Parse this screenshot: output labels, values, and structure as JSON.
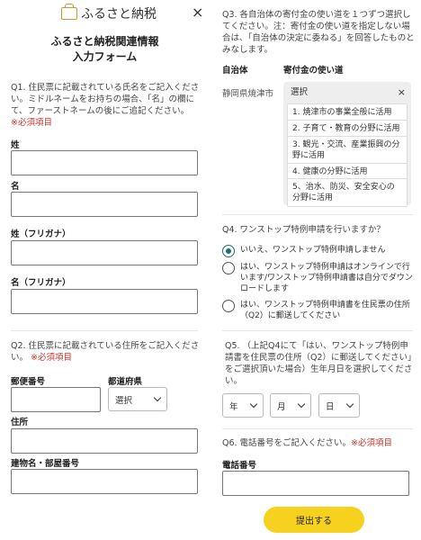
{
  "header": {
    "logo_text": "ふるさと納税",
    "close_icon": "×",
    "title_line1": "ふるさと納税関連情報",
    "title_line2": "入力フォーム"
  },
  "q1": {
    "text": "Q1. 住民票に記載されている氏名をご記入ください。ミドルネームをお持ちの場合、「名」の欄にて、ファーストネームの後にご追記ください。",
    "required": "※必須項目",
    "labels": [
      "姓",
      "名",
      "姓（フリガナ）",
      "名（フリガナ）"
    ]
  },
  "q2": {
    "text": "Q2. 住民票に記載されている住所をご記入ください。",
    "required": "※必須項目",
    "postal_label": "郵便番号",
    "pref_label": "都道府県",
    "pref_select": "選択",
    "address_label": "住所",
    "building_label": "建物名・部屋番号"
  },
  "q3": {
    "text": "Q3. 各自治体の寄付金の使い道を１つずつ選択してください。注：寄付金の使い道を指定しない場合は、「自治体の決定に委ねる」を回答したものとみなします。",
    "col_municipality": "自治体",
    "col_usage": "寄付金の使い道",
    "municipality": "静岡県焼津市",
    "select_header": "選択",
    "close_icon": "×",
    "options": [
      "1. 焼津市の事業全般に活用",
      "2. 子育て・教育の分野に活用",
      "3. 観光・交流、産業振興の分野に活用",
      "4. 健康の分野に活用",
      "5、治水、防災、安全安心の分野に活用"
    ]
  },
  "q4": {
    "text": "Q4. ワンストップ特例申請を行いますか？",
    "options": [
      "いいえ、ワンストップ特例申請しません",
      "はい、ワンストップ特例申請はオンラインで行います/ワンストップ特例申請書は自分でダウンロードします",
      "はい、ワンストップ特例申請書を住民票の住所（Q2）に郵送してください"
    ],
    "selected_index": 0
  },
  "q5": {
    "text": "Q5. （上記Q4にて「はい、ワンストップ特例申請書を住民票の住所（Q2）に郵送してください」をご選択頂いた場合）生年月日を選択してください。",
    "year": "年",
    "month": "月",
    "day": "日"
  },
  "q6": {
    "text": "Q6. 電話番号をご記入ください。",
    "required": "※必須項目",
    "phone_label": "電話番号"
  },
  "submit_label": "提出する",
  "colors": {
    "required": "#d0342c",
    "submit_bg": "#f6d21e",
    "radio_selected": "#1f6f6d",
    "logo": "#c79a3a"
  }
}
